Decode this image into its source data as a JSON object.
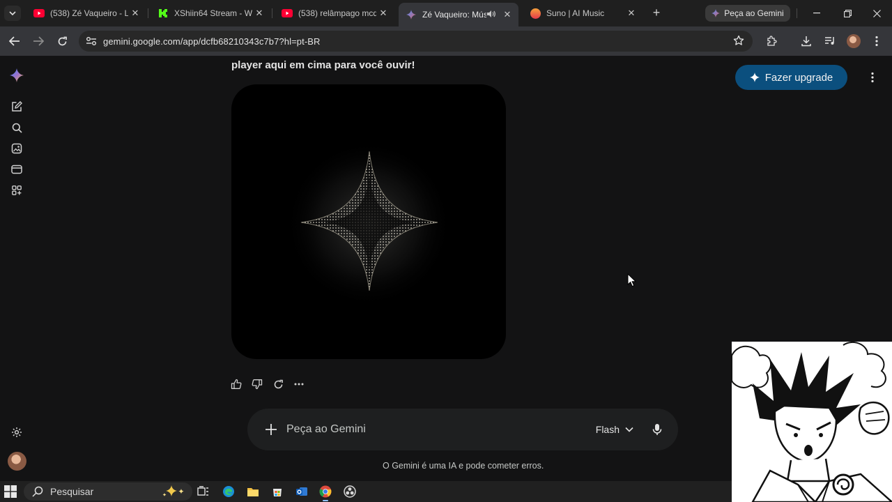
{
  "browser": {
    "tabs": [
      {
        "title": "(538) Zé Vaqueiro - Let",
        "favicon": "youtube-icon",
        "color": "#ff0033"
      },
      {
        "title": "XShiin64 Stream - Wat",
        "favicon": "kick-icon",
        "color": "#53fc18"
      },
      {
        "title": "(538) relâmpago mcqu",
        "favicon": "youtube-icon",
        "color": "#ff0033"
      },
      {
        "title": "Zé Vaqueiro: Músi",
        "favicon": "gemini-icon",
        "active": true
      },
      {
        "title": "Suno | AI Music",
        "favicon": "suno-icon",
        "color": "#f26b3a"
      }
    ],
    "ask_gemini_label": "Peça ao Gemini",
    "url": "gemini.google.com/app/dcfb68210343c7b7?hl=pt-BR"
  },
  "chat": {
    "message_tail": "player aqui em cima para você ouvir!",
    "upgrade_label": "Fazer upgrade",
    "prompt_placeholder": "Peça ao Gemini",
    "model_label": "Flash",
    "disclaimer": "O Gemini é uma IA e pode cometer erros."
  },
  "taskbar": {
    "search_label": "Pesquisar"
  },
  "colors": {
    "background": "#131314",
    "upgrade": "#0b4f7e",
    "prompt_bg": "#1e1f20"
  }
}
